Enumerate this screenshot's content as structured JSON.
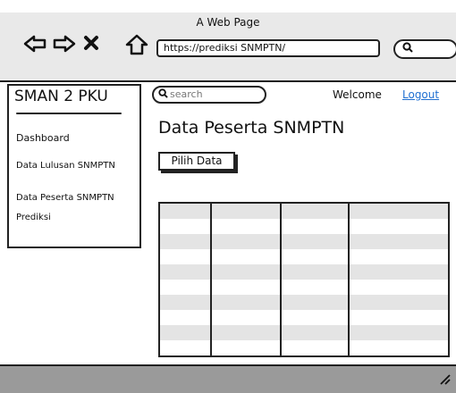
{
  "browser": {
    "title": "A Web Page",
    "url": "https://prediksi SNMPTN/",
    "icons": [
      "back-arrow-icon",
      "forward-arrow-icon",
      "close-icon",
      "home-icon",
      "search-icon"
    ]
  },
  "sidebar": {
    "brand": "SMAN 2 PKU",
    "items": [
      {
        "label": "Dashboard"
      },
      {
        "label": "Data Lulusan SNMPTN"
      },
      {
        "label": "Data Peserta SNMPTN"
      },
      {
        "label": "Prediksi"
      }
    ]
  },
  "header": {
    "search_placeholder": "search",
    "welcome": "Welcome",
    "logout": "Logout"
  },
  "main": {
    "title": "Data Peserta SNMPTN",
    "pilih_button": "Pilih Data"
  },
  "colors": {
    "link": "#1f6fd1",
    "chrome": "#e9e9e9",
    "footer": "#9a9a9a",
    "row_alt": "#e4e4e4"
  }
}
